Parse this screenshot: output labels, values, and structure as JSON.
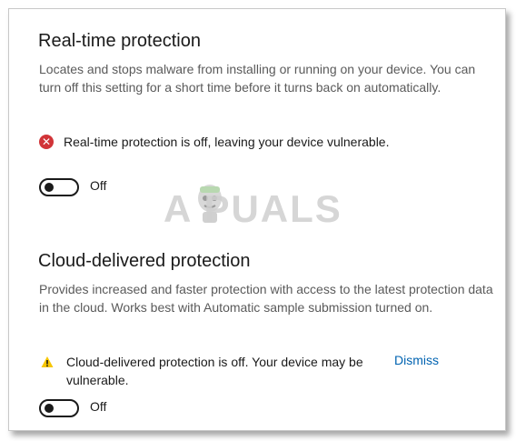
{
  "realtime": {
    "title": "Real-time protection",
    "description": "Locates and stops malware from installing or running on your device. You can turn off this setting for a short time before it turns back on automatically.",
    "status_icon": "error-circle-icon",
    "status_text": "Real-time protection is off, leaving your device vulnerable.",
    "toggle_label": "Off",
    "toggle_on": false
  },
  "cloud": {
    "title": "Cloud-delivered protection",
    "description": "Provides increased and faster protection with access to the latest protection data in the cloud.  Works best with Automatic sample submission turned on.",
    "status_icon": "warning-triangle-icon",
    "status_text_line1": "Cloud-delivered protection is off. Your device may be",
    "status_text_line2": "vulnerable.",
    "dismiss_label": "Dismiss",
    "toggle_label": "Off",
    "toggle_on": false
  },
  "watermark": {
    "text": "A  PUALS"
  },
  "colors": {
    "error": "#d13438",
    "warning": "#f7c600",
    "link": "#0063b1"
  }
}
